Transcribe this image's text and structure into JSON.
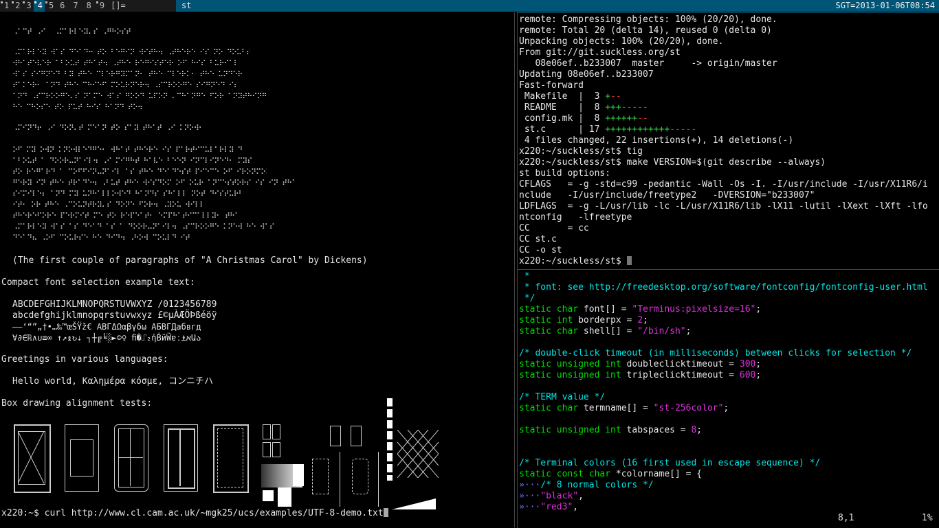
{
  "bar": {
    "tags": [
      "1",
      "2",
      "3",
      "4",
      "5",
      "6",
      "7",
      "8",
      "9"
    ],
    "selected_tag": "4",
    "layout": "[]=",
    "window_title": "st",
    "clock": "SGT=2013-01-06T08:54"
  },
  "left": {
    "caption": "(The first couple of paragraphs of \"A Christmas Carol\" by Dickens)",
    "compact_heading": "Compact font selection example text:",
    "compact_lines": [
      "ABCDEFGHIJKLMNOPQRSTUVWXYZ /0123456789",
      "abcdefghijklmnopqrstuvwxyz £©µÀÆÖÞßéöÿ",
      "–—‘“”„†•…‰™œŠŸž€ ΑΒΓΔΩαβγδω АБВГДабвгд",
      "∀∂∈ℝ∧∪≡∞ ↑↗↨↻⇣ ┐┼╔╘░►☺♀ ﬁ�⑀₂ἠḂӥẄɐː⍎אԱა"
    ],
    "greetings_heading": "Greetings in various languages:",
    "greetings_line": "Hello world, Καλημέρα κόσμε, コンニチハ",
    "boxdraw_heading": "Box drawing alignment tests:",
    "prompt": "x220:~$ curl http://www.cl.cam.ac.uk/~mgk25/ucs/examples/UTF-8-demo.txt"
  },
  "rtop": {
    "lines": [
      "remote: Compressing objects: 100% (20/20), done.",
      "remote: Total 20 (delta 14), reused 0 (delta 0)",
      "Unpacking objects: 100% (20/20), done.",
      "From git://git.suckless.org/st",
      "   08e06ef..b233007  master     -> origin/master",
      "Updating 08e06ef..b233007",
      "Fast-forward"
    ],
    "diffstat": [
      {
        "file": " Makefile  |  3 ",
        "plus": "+",
        "minus": "--"
      },
      {
        "file": " README    |  8 ",
        "plus": "+++",
        "minus": "-----"
      },
      {
        "file": " config.mk |  8 ",
        "plus": "++++++",
        "minus": "--"
      },
      {
        "file": " st.c      | 17 ",
        "plus": "++++++++++++",
        "minus": "-----"
      }
    ],
    "lines2": [
      " 4 files changed, 22 insertions(+), 14 deletions(-)",
      "x220:~/suckless/st$ tig",
      "x220:~/suckless/st$ make VERSION=$(git describe --always)",
      "st build options:",
      "CFLAGS   = -g -std=c99 -pedantic -Wall -Os -I. -I/usr/include -I/usr/X11R6/i",
      "nclude   -I/usr/include/freetype2   -DVERSION=\"b233007\"",
      "LDFLAGS  = -g -L/usr/lib -lc -L/usr/X11R6/lib -lX11 -lutil -lXext -lXft -lfo",
      "ntconfig   -lfreetype",
      "CC       = cc",
      "CC st.c",
      "CC -o st"
    ],
    "prompt": "x220:~/suckless/st$ "
  },
  "rbot": {
    "c1": " *",
    "c2a": " * font: see ",
    "c2b": "http://freedesktop.org/software/fontconfig/fontconfig-user.html",
    "c3": " */",
    "kw_static_char": "static char",
    "kw_static_int": "static int",
    "kw_static_unsigned_int": "static unsigned int",
    "kw_static_const_char": "static const char",
    "font_decl": " font[] = ",
    "font_val": "\"Terminus:pixelsize=16\"",
    "border_decl": " borderpx = ",
    "border_val": "2",
    "shell_decl": " shell[] = ",
    "shell_val": "\"/bin/sh\"",
    "comment_dbl": "/* double-click timeout (in milliseconds) between clicks for selection */",
    "dbl_decl": " doubleclicktimeout = ",
    "dbl_val": "300",
    "tpl_decl": " tripleclicktimeout = ",
    "tpl_val": "600",
    "comment_term": "/* TERM value */",
    "term_decl": " termname[] = ",
    "term_val": "\"st-256color\"",
    "tab_decl": " tabspaces = ",
    "tab_val": "8",
    "comment_colors": "/* Terminal colors (16 first used in escape sequence) */",
    "colorname_decl": " *colorname[] = {",
    "tab_mark": "»···",
    "comment_8": "/* 8 normal colors */",
    "black": "\"black\"",
    "red3": "\"red3\"",
    "status_pos": "8,1",
    "status_pct": "1%"
  }
}
